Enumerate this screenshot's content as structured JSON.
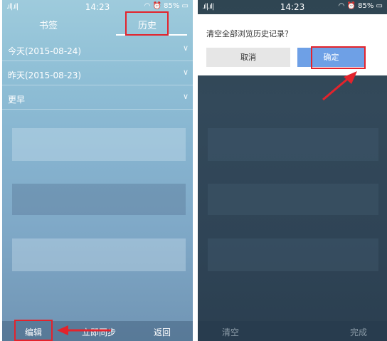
{
  "status_bar": {
    "signal": ".ıl|.ıl|",
    "time": "14:23",
    "battery": "85%"
  },
  "left": {
    "tabs": {
      "bookmark": "书签",
      "history": "历史"
    },
    "history_rows": [
      {
        "label": "今天(2015-08-24)"
      },
      {
        "label": "昨天(2015-08-23)"
      },
      {
        "label": "更早"
      }
    ],
    "bottom": {
      "edit": "编辑",
      "sync": "立即同步",
      "back": "返回"
    }
  },
  "right": {
    "dialog": {
      "message": "清空全部浏览历史记录？",
      "cancel": "取消",
      "confirm": "确定"
    },
    "bottom": {
      "clear": "清空",
      "done": "完成"
    }
  },
  "colors": {
    "annotation_red": "#e3232c",
    "confirm_blue": "#6ea0e6"
  }
}
